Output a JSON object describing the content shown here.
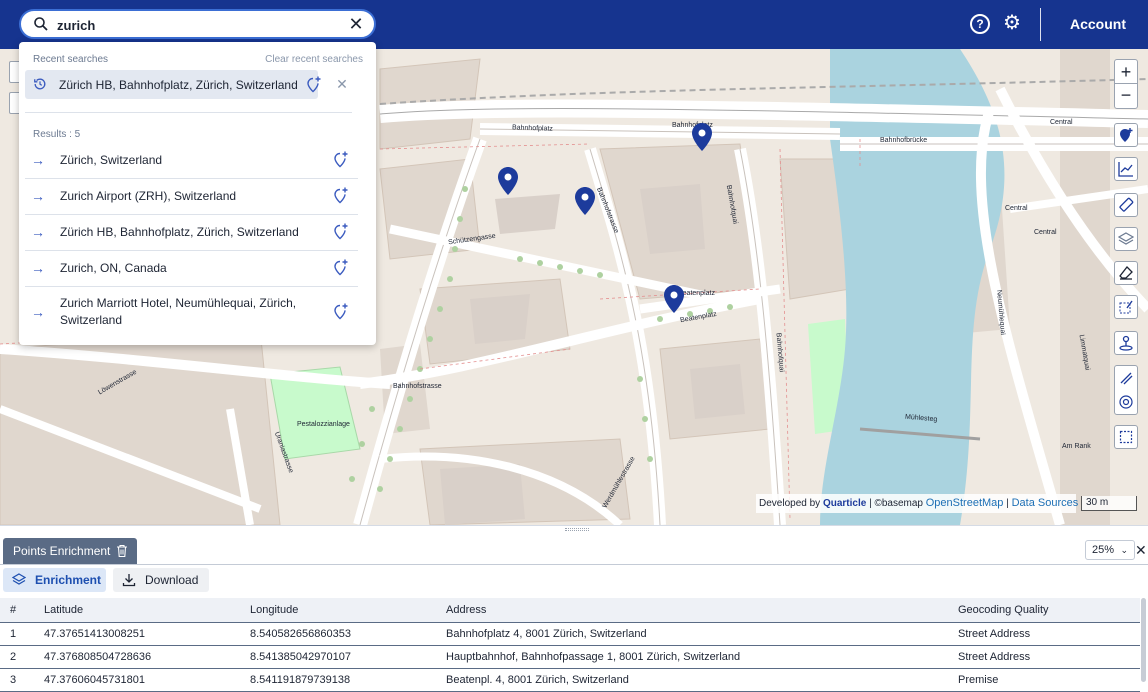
{
  "header": {
    "help_icon": "question-circle-icon",
    "settings_icon": "gear-icon",
    "account_label": "Account",
    "bar_color": "#16348f"
  },
  "search": {
    "value": "zurich",
    "placeholder": "",
    "icon": "search-icon",
    "clear_icon": "close-icon"
  },
  "dropdown": {
    "recent_heading": "Recent searches",
    "clear_recent_label": "Clear recent searches",
    "recent_items": [
      {
        "label": "Zürich HB, Bahnhofplatz, Zürich, Switzerland",
        "icon": "history-icon"
      }
    ],
    "results_label": "Results : 5",
    "results": [
      {
        "label": "Zürich, Switzerland"
      },
      {
        "label": "Zurich Airport (ZRH), Switzerland"
      },
      {
        "label": "Zürich HB, Bahnhofplatz, Zürich, Switzerland"
      },
      {
        "label": "Zurich, ON, Canada"
      },
      {
        "label": "Zurich Marriott Hotel, Neumühlequai, Zürich, Switzerland"
      }
    ]
  },
  "map": {
    "labels": [
      "Bahnhofplatz",
      "Bahnhofplatz",
      "Bahnhofbrücke",
      "Bahnhofquai",
      "Bahnhofquai",
      "Schützengasse",
      "Bahnhofstrasse",
      "Bahnhofstrasse",
      "Beatenplatz",
      "Beatenplatz",
      "Pestalozzianlage",
      "Uraniastrasse",
      "Löwenstrasse",
      "Mühlesteg",
      "Central",
      "Central",
      "Central",
      "Werdmühlestrasse",
      "Am Rank",
      "Limmatquai",
      "Neumühlequai"
    ],
    "attribution": {
      "developed_by": "Developed by",
      "brand": "Quarticle",
      "basemap": "| ©basemap",
      "osm": "OpenStreetMap",
      "sep": "|",
      "data_sources": "Data Sources"
    },
    "scale": "30 m",
    "water_color": "#aad3df",
    "marker_color": "#1d3b9c"
  },
  "panel": {
    "tab_label": "Points Enrichment",
    "zoom_value": "25%",
    "enrichment_label": "Enrichment",
    "download_label": "Download",
    "columns": [
      "#",
      "Latitude",
      "Longitude",
      "Address",
      "Geocoding Quality"
    ],
    "rows": [
      [
        "1",
        "47.37651413008251",
        "8.540582656860353",
        "Bahnhofplatz 4, 8001 Zürich, Switzerland",
        "Street Address"
      ],
      [
        "2",
        "47.376808504728636",
        "8.541385042970107",
        "Hauptbahnhof, Bahnhofpassage 1, 8001 Zürich, Switzerland",
        "Street Address"
      ],
      [
        "3",
        "47.37606045731801",
        "8.541191879739138",
        "Beatenpl. 4, 8001 Zürich, Switzerland",
        "Premise"
      ]
    ]
  }
}
